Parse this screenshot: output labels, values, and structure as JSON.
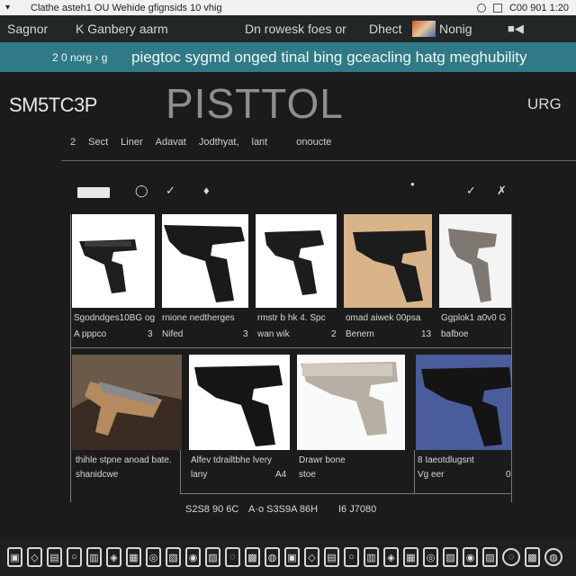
{
  "sysbar": {
    "title": "Clathe asteh1 OU Wehide gfignsids 10 vhig",
    "clock": "C00 901 1:20",
    "menu_icon": "dropdown-icon",
    "status_icon": "circle-icon",
    "window_icon": "square-icon"
  },
  "nav": {
    "item1": "Sagnor",
    "item2": "K Ganbery aarm",
    "item3": "Dn rowesk foes or",
    "item4": "Dhect",
    "item5": "Nonig",
    "item6": "■◀"
  },
  "banner": {
    "prefix": "2 0 norg › g",
    "text": "piegtoc sygmd onged tinal bing gceacling hatg meghubility"
  },
  "header": {
    "left": "SM5TC3P",
    "center": "PISTTOL",
    "right": "URG"
  },
  "subnav": [
    "2",
    "Sect",
    "Liner",
    "Adavat",
    "Jodthyat,",
    "lant",
    "onoucte"
  ],
  "toolbar": {
    "icons": [
      "tag-icon",
      "wrench-icon",
      "pencil-icon",
      "dot-icon",
      "edit-icon",
      "pen-icon"
    ]
  },
  "row1": [
    {
      "line1": "Sgodndges10BG og",
      "line2": "A pppco",
      "num": "3"
    },
    {
      "line1": "rnione nedtherges",
      "line2": "Nifed",
      "num": "3"
    },
    {
      "line1": "rmstr b hk 4. Spc",
      "line2": "wan wik",
      "num": "2"
    },
    {
      "line1": "omad aiwek 00psa",
      "line2": "Benem",
      "num": "13"
    },
    {
      "line1": "Ggplok1 a0v0 G",
      "line2": "bafboe",
      "num": ""
    }
  ],
  "row2": [
    {
      "line1": "thihle stpne anoad bate.",
      "line2": "shanidcwe",
      "num": ""
    },
    {
      "line1": "Alfev tdrailtbhe lvery",
      "line2": "lany",
      "num": "A4"
    },
    {
      "line1": "Drawr bone",
      "line2": "stoe",
      "num": ""
    },
    {
      "line1": "8 Iaeotdlugsnt",
      "line2": "Vg eer",
      "num": "0"
    }
  ],
  "footer": {
    "left": "S2S8 90 6C",
    "mid": "A·o S3S9A 86H",
    "right": "I6 J7080"
  },
  "dock_count": 28
}
